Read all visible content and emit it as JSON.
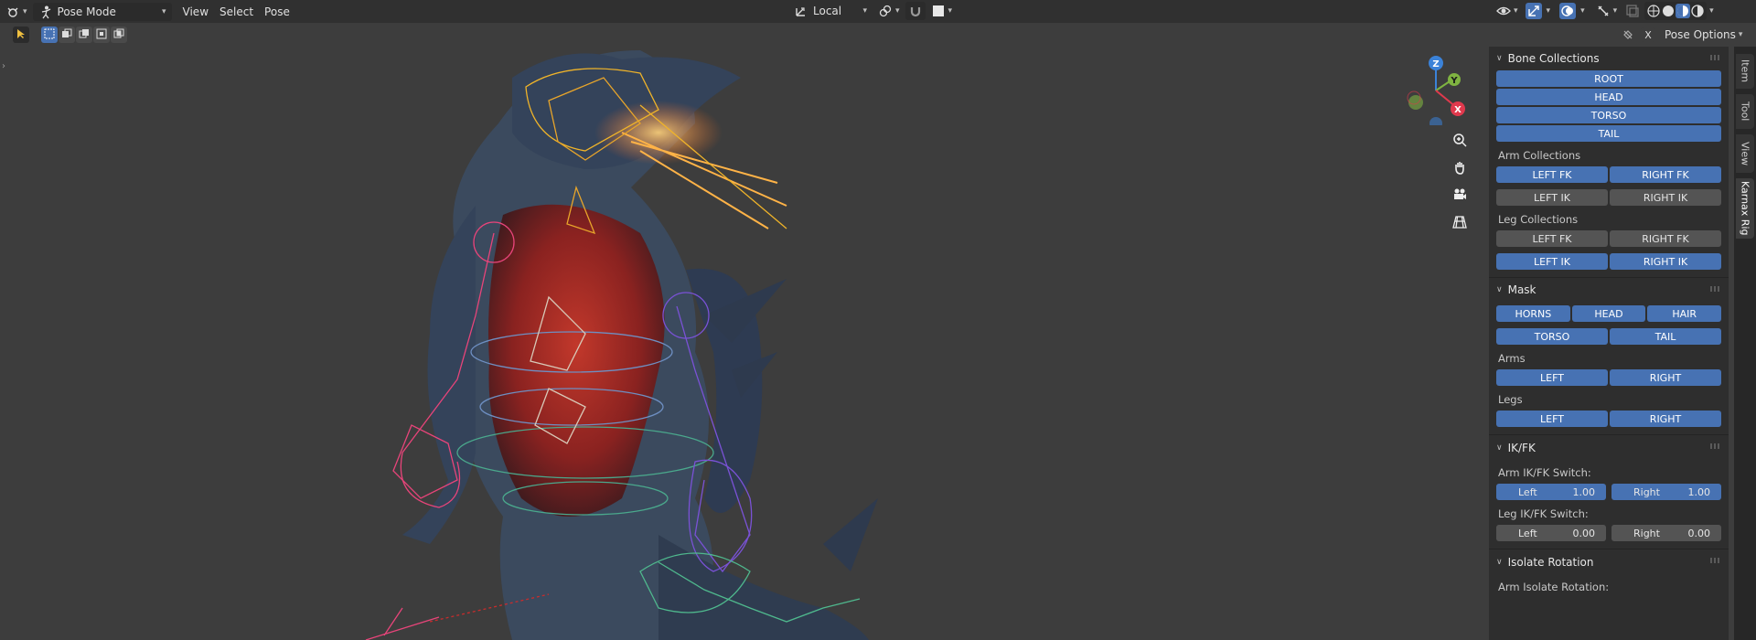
{
  "header": {
    "mode_label": "Pose Mode",
    "menus": [
      "View",
      "Select",
      "Pose"
    ],
    "transform_orientation": "Local",
    "pose_options": "Pose Options"
  },
  "sidebar": {
    "tabs": [
      "Item",
      "Tool",
      "View",
      "Karnax Rig"
    ],
    "bone_collections": {
      "title": "Bone Collections",
      "main": [
        "ROOT",
        "HEAD",
        "TORSO",
        "TAIL"
      ],
      "arm_label": "Arm Collections",
      "arm_rows": [
        [
          "LEFT FK",
          "RIGHT FK"
        ],
        [
          "LEFT IK",
          "RIGHT IK"
        ]
      ],
      "leg_label": "Leg Collections",
      "leg_rows": [
        [
          "LEFT FK",
          "RIGHT FK"
        ],
        [
          "LEFT IK",
          "RIGHT IK"
        ]
      ]
    },
    "mask": {
      "title": "Mask",
      "row1": [
        "HORNS",
        "HEAD",
        "HAIR"
      ],
      "row2": [
        "TORSO",
        "TAIL"
      ],
      "arms_label": "Arms",
      "arms": [
        "LEFT",
        "RIGHT"
      ],
      "legs_label": "Legs",
      "legs": [
        "LEFT",
        "RIGHT"
      ]
    },
    "ikfk": {
      "title": "IK/FK",
      "arm_label": "Arm IK/FK Switch:",
      "arm_left": {
        "name": "Left",
        "value": "1.00"
      },
      "arm_right": {
        "name": "Right",
        "value": "1.00"
      },
      "leg_label": "Leg IK/FK Switch:",
      "leg_left": {
        "name": "Left",
        "value": "0.00"
      },
      "leg_right": {
        "name": "Right",
        "value": "0.00"
      }
    },
    "isolate": {
      "title": "Isolate Rotation",
      "arm_label": "Arm Isolate Rotation:"
    }
  },
  "gizmo": {
    "z": "Z",
    "y": "Y",
    "x": "X"
  },
  "colors": {
    "accent": "#4772b3",
    "panel": "#2e2e2e",
    "viewport": "#3d3d3d"
  }
}
